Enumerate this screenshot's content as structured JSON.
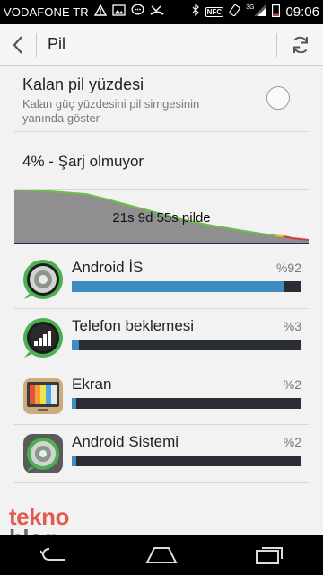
{
  "statusbar": {
    "carrier": "VODAFONE TR",
    "nfc": "NFC",
    "network": "3G",
    "time": "09:06"
  },
  "actionbar": {
    "title": "Pil"
  },
  "setting": {
    "title": "Kalan pil yüzdesi",
    "subtitle": "Kalan güç yüzdesini pil simgesinin yanında göster",
    "checked": false
  },
  "battery": {
    "status": "4% - Şarj olmuyor",
    "graph_label": "21s 9d 55s pilde"
  },
  "apps": [
    {
      "name": "Android İS",
      "percent_label": "%92",
      "percent": 92,
      "icon": "android-os-icon"
    },
    {
      "name": "Telefon beklemesi",
      "percent_label": "%3",
      "percent": 3,
      "icon": "phone-standby-icon"
    },
    {
      "name": "Ekran",
      "percent_label": "%2",
      "percent": 2,
      "icon": "screen-icon"
    },
    {
      "name": "Android Sistemi",
      "percent_label": "%2",
      "percent": 2,
      "icon": "android-system-icon"
    }
  ],
  "watermark": {
    "line1": "tekno",
    "line2": "blog"
  },
  "colors": {
    "accent": "#3e8cc1",
    "bar_track": "#2a2e34",
    "graph_fill": "#8f8f8f",
    "graph_line_green": "#6cc04a",
    "graph_line_red": "#d23a3a",
    "baseline": "#1e2a7a"
  }
}
